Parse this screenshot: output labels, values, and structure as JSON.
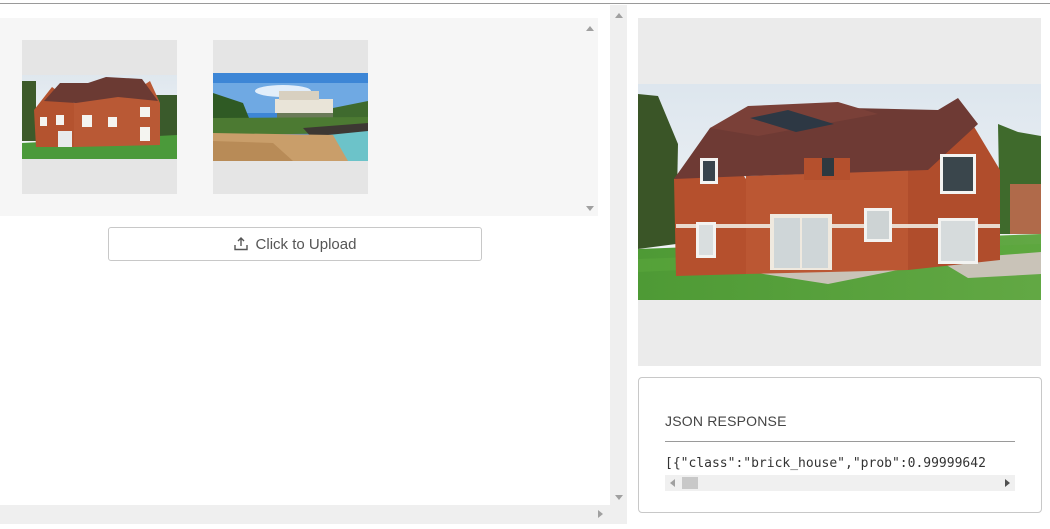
{
  "gallery": {
    "images": [
      {
        "name": "brick-house-thumbnail"
      },
      {
        "name": "beach-house-thumbnail"
      }
    ]
  },
  "upload": {
    "label": "Click to Upload",
    "icon": "upload-icon"
  },
  "preview": {
    "image": "brick-house-preview"
  },
  "json_response": {
    "title": "JSON RESPONSE",
    "body": "[{\"class\":\"brick_house\",\"prob\":0.99999642"
  },
  "colors": {
    "panel_bg": "#f6f6f6",
    "image_placeholder": "#e5e5e5",
    "scrollbar_track": "#efefef",
    "button_border": "#c8c8c8",
    "text": "#444444"
  }
}
